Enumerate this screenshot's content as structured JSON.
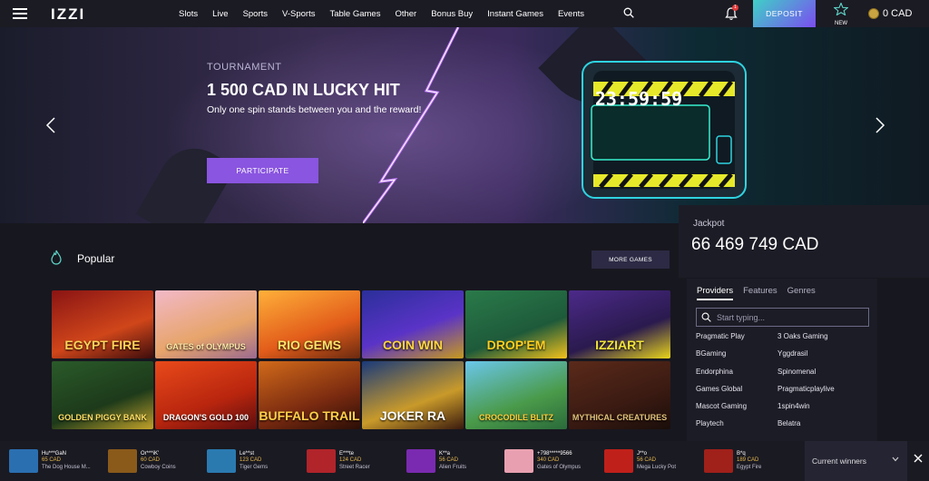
{
  "header": {
    "logo": "IZZI",
    "nav": [
      "Slots",
      "Live",
      "Sports",
      "V-Sports",
      "Table Games",
      "Other",
      "Bonus Buy",
      "Instant Games",
      "Events"
    ],
    "notification_count": "1",
    "deposit_label": "DEPOSIT",
    "new_label": "NEW",
    "balance": "0 CAD"
  },
  "hero": {
    "tag": "TOURNAMENT",
    "title": "1 500 CAD IN LUCKY HIT",
    "subtitle": "Only one spin stands between you and the reward!",
    "cta": "PARTICIPATE",
    "timer": "23:59:59"
  },
  "jackpot": {
    "label": "Jackpot",
    "value": "66 469 749 CAD"
  },
  "popular": {
    "title": "Popular",
    "more_label": "MORE GAMES"
  },
  "games": [
    {
      "title": "EGYPT FIRE",
      "bg": "linear-gradient(160deg,#8a1414,#d0461a 60%,#3d0c0c)",
      "color": "#ffd35a"
    },
    {
      "title": "GATES of OLYMPUS",
      "bg": "linear-gradient(160deg,#f2b9c8,#e7a46a 60%,#9b6a8f)",
      "color": "#ffe9a8"
    },
    {
      "title": "RIO GEMS",
      "bg": "linear-gradient(160deg,#ffb03a,#e25c1a 60%,#6a2a10)",
      "color": "#ffe36a"
    },
    {
      "title": "COIN WIN",
      "bg": "linear-gradient(160deg,#2b2f9a,#5a33c7 55%,#c79a1e)",
      "color": "#ffd640"
    },
    {
      "title": "DROP'EM",
      "bg": "linear-gradient(160deg,#2a7a4a,#1e5a3a 60%,#f3c21b)",
      "color": "#ffcf1f"
    },
    {
      "title": "IZZIART",
      "bg": "linear-gradient(160deg,#4c2a8a,#2a1a4e 60%,#e9d51b)",
      "color": "#f0e33a"
    },
    {
      "title": "GOLDEN PIGGY BANK",
      "bg": "linear-gradient(160deg,#2a5a2a,#1d3a1a 60%,#c2a22a)",
      "color": "#ffe066"
    },
    {
      "title": "DRAGON'S GOLD 100",
      "bg": "linear-gradient(160deg,#e84a1a,#b8250e 60%,#5a0e0e)",
      "color": "#ffffff"
    },
    {
      "title": "BUFFALO TRAIL",
      "bg": "linear-gradient(160deg,#d16a1a,#7a2a10 60%,#2a0e06)",
      "color": "#ffd04a"
    },
    {
      "title": "JOKER RA",
      "bg": "linear-gradient(160deg,#1a3a7a,#c99a2a 60%,#3a1a0e)",
      "color": "#ffffff"
    },
    {
      "title": "CROCODILE BLITZ",
      "bg": "linear-gradient(160deg,#6ac6ea,#4a9a4a 60%,#2a6a3a)",
      "color": "#ffcf3a"
    },
    {
      "title": "MYTHICAL CREATURES",
      "bg": "linear-gradient(160deg,#5a2a1a,#3a1a12 60%,#1a0e0a)",
      "color": "#e2c27a"
    }
  ],
  "providers": {
    "tabs": [
      "Providers",
      "Features",
      "Genres"
    ],
    "search_placeholder": "Start typing...",
    "items": [
      "Pragmatic Play",
      "3 Oaks Gaming",
      "BGaming",
      "Yggdrasil",
      "Endorphina",
      "Spinomenal",
      "Games Global",
      "Pragmaticplaylive",
      "Mascot Gaming",
      "1spin4win",
      "Playtech",
      "Belatra"
    ]
  },
  "winners": [
    {
      "name": "Hu***GaN",
      "amount": "65 CAD",
      "game": "The Dog House M...",
      "bg": "#2a6fb0"
    },
    {
      "name": "Or***iK'",
      "amount": "60 CAD",
      "game": "Cowboy Coins",
      "bg": "#8a5a1a"
    },
    {
      "name": "Le**st",
      "amount": "123 CAD",
      "game": "Tiger Gems",
      "bg": "#2a7ab0"
    },
    {
      "name": "E***te",
      "amount": "124 CAD",
      "game": "Street Racer",
      "bg": "#b0242a"
    },
    {
      "name": "K**a",
      "amount": "56 CAD",
      "game": "Alien Fruits",
      "bg": "#7a2ab0"
    },
    {
      "name": "+798*****9566",
      "amount": "340 CAD",
      "game": "Gates of Olympus",
      "bg": "#e8a0b0"
    },
    {
      "name": "J**o",
      "amount": "56 CAD",
      "game": "Mega Lucky Pot",
      "bg": "#c0201a"
    },
    {
      "name": "B*q",
      "amount": "189 CAD",
      "game": "Egypt Fire",
      "bg": "#a0201a"
    }
  ],
  "current_winners_label": "Current winners",
  "colors": {
    "accent": "#8a55e0",
    "deposit_from": "#3fd0c7",
    "deposit_to": "#7b4df0",
    "gold": "#e5b84c"
  }
}
